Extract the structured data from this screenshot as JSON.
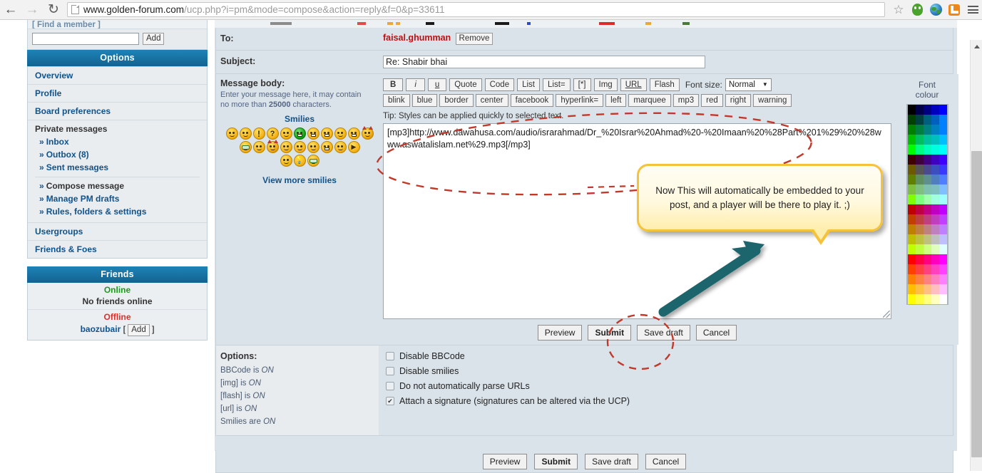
{
  "browser": {
    "back_icon": "back-arrow-icon",
    "forward_icon": "forward-arrow-icon",
    "reload_icon": "reload-icon",
    "url_host": "www.golden-forum.com",
    "url_path": "/ucp.php?i=pm&mode=compose&action=reply&f=0&p=33611",
    "star_icon": "☆",
    "menu_icon": "hamburger-menu-icon"
  },
  "sidebar": {
    "find_member": {
      "header": "[ Find a member ]",
      "input_value": "",
      "add_label": "Add"
    },
    "options_panel": {
      "title": "Options",
      "rows": [
        {
          "label": "Overview"
        },
        {
          "label": "Profile"
        },
        {
          "label": "Board preferences"
        }
      ],
      "group_title": "Private messages",
      "group_items": [
        {
          "label": "Inbox",
          "current": false
        },
        {
          "label": "Outbox (8)",
          "current": false
        },
        {
          "label": "Sent messages",
          "current": false
        },
        {
          "label": "Compose message",
          "current": true
        },
        {
          "label": "Manage PM drafts",
          "current": false
        },
        {
          "label": "Rules, folders & settings",
          "current": false
        }
      ],
      "rows_after": [
        {
          "label": "Usergroups"
        },
        {
          "label": "Friends & Foes"
        }
      ]
    },
    "friends_panel": {
      "title": "Friends",
      "online_label": "Online",
      "online_text": "No friends online",
      "offline_label": "Offline",
      "offline_user": "baozubair",
      "offline_add_open": "[",
      "offline_add_label": "Add",
      "offline_add_close": "]"
    }
  },
  "form": {
    "to_label": "To:",
    "to_recipient": "faisal.ghumman",
    "to_remove_label": "Remove",
    "subject_label": "Subject:",
    "subject_value": "Re: Shabir bhai",
    "body_label": "Message body:",
    "body_hint_1": "Enter your message here, it may contain",
    "body_hint_2_pre": "no more than ",
    "body_hint_2_num": "25000",
    "body_hint_2_post": " characters.",
    "smilies": {
      "title": "Smilies",
      "row1_count": 11,
      "row2_count": 9,
      "row3_count": 3,
      "view_more_label": "View more smilies"
    },
    "bbcode_row1": [
      {
        "label": "B",
        "style": "b"
      },
      {
        "label": "i",
        "style": "i"
      },
      {
        "label": "u",
        "style": "u"
      },
      {
        "label": "Quote",
        "style": ""
      },
      {
        "label": "Code",
        "style": ""
      },
      {
        "label": "List",
        "style": ""
      },
      {
        "label": "List=",
        "style": ""
      },
      {
        "label": "[*]",
        "style": ""
      },
      {
        "label": "Img",
        "style": ""
      },
      {
        "label": "URL",
        "style": "url"
      },
      {
        "label": "Flash",
        "style": ""
      }
    ],
    "font_size_label": "Font size:",
    "font_size_value": "Normal",
    "font_size_caret": "▼",
    "bbcode_row2": [
      {
        "label": "blink"
      },
      {
        "label": "blue"
      },
      {
        "label": "border"
      },
      {
        "label": "center"
      },
      {
        "label": "facebook"
      },
      {
        "label": "hyperlink="
      },
      {
        "label": "left"
      },
      {
        "label": "marquee"
      },
      {
        "label": "mp3"
      },
      {
        "label": "red"
      },
      {
        "label": "right"
      },
      {
        "label": "warning"
      }
    ],
    "tip_text": "Tip: Styles can be applied quickly to selected text.",
    "textarea_value": "[mp3]http://www.dawahusa.com/audio/israrahmad/Dr_%20Israr%20Ahmad%20-%20Imaan%20%28Part%201%29%20%28www.aswatalislam.net%29.mp3[/mp3]",
    "editor_buttons": [
      {
        "label": "Preview",
        "primary": false
      },
      {
        "label": "Submit",
        "primary": true
      },
      {
        "label": "Save draft",
        "primary": false
      },
      {
        "label": "Cancel",
        "primary": false
      }
    ],
    "font_colour_title_1": "Font",
    "font_colour_title_2": "colour",
    "options_label": "Options:",
    "option_lines": [
      {
        "name": "BBCode",
        "verb": " is ",
        "state": "ON"
      },
      {
        "name": "[img]",
        "verb": " is ",
        "state": "ON"
      },
      {
        "name": "[flash]",
        "verb": " is ",
        "state": "ON"
      },
      {
        "name": "[url]",
        "verb": " is ",
        "state": "ON"
      },
      {
        "name": "Smilies",
        "verb": " are ",
        "state": "ON"
      }
    ],
    "checkboxes": [
      {
        "label": "Disable BBCode",
        "checked": false
      },
      {
        "label": "Disable smilies",
        "checked": false
      },
      {
        "label": "Do not automatically parse URLs",
        "checked": false
      },
      {
        "label": "Attach a signature (signatures can be altered via the UCP)",
        "checked": true
      }
    ],
    "footer_buttons": [
      {
        "label": "Preview",
        "primary": false
      },
      {
        "label": "Submit",
        "primary": true
      },
      {
        "label": "Save draft",
        "primary": false
      },
      {
        "label": "Cancel",
        "primary": false
      }
    ]
  },
  "annotations": {
    "callout_text": "Now This will automatically be embedded to your post, and a player will be there to play it. ;)",
    "callout_border_color": "#f5c33b",
    "ellipse_color": "#c0392b",
    "arrow_color": "#1d656d"
  },
  "palette": {
    "columns": 5,
    "colors": [
      "#000000",
      "#00004b",
      "#000080",
      "#0000bf",
      "#0000ff",
      "#004000",
      "#004040",
      "#005f7f",
      "#0060bf",
      "#0080ff",
      "#008000",
      "#008040",
      "#008080",
      "#0080bf",
      "#0080ff",
      "#00bf00",
      "#00bf60",
      "#00bf9f",
      "#00bfbf",
      "#00bfff",
      "#00ff00",
      "#00ff80",
      "#00ffbf",
      "#00ffdf",
      "#00ffff",
      "#400000",
      "#400040",
      "#40007f",
      "#4000bf",
      "#4000ff",
      "#6b5a00",
      "#555555",
      "#4a4a8f",
      "#3b4fbf",
      "#3a3aff",
      "#5f8000",
      "#5f8f5f",
      "#5f8f8f",
      "#4f7fbf",
      "#4f7fff",
      "#7fbf3f",
      "#7fbf7f",
      "#7fbfaf",
      "#7fbfbf",
      "#7fbfff",
      "#7fff00",
      "#7fff7f",
      "#9fffaf",
      "#9fffdf",
      "#9fffff",
      "#bf0000",
      "#bf0040",
      "#bf0080",
      "#bf00bf",
      "#bf00ff",
      "#bf4000",
      "#bf4040",
      "#bf4080",
      "#bf40bf",
      "#bf40ff",
      "#bf8000",
      "#bf8040",
      "#bf8080",
      "#bf80bf",
      "#bf80ff",
      "#bfbf00",
      "#bfbf40",
      "#bfbf80",
      "#bfbfbf",
      "#bfbfff",
      "#bfff00",
      "#bfff40",
      "#cfff80",
      "#dfffbf",
      "#dfffff",
      "#ff0000",
      "#ff0040",
      "#ff0080",
      "#ff00bf",
      "#ff00ff",
      "#ff4000",
      "#ff4040",
      "#ff4080",
      "#ff40bf",
      "#ff40ff",
      "#ff8000",
      "#ff8040",
      "#ff8080",
      "#ff80bf",
      "#ff80ff",
      "#ffbf00",
      "#ffbf40",
      "#ffbf80",
      "#ffbfbf",
      "#ffbfff",
      "#ffff00",
      "#ffff40",
      "#ffff80",
      "#ffffbf",
      "#ffffff"
    ]
  }
}
